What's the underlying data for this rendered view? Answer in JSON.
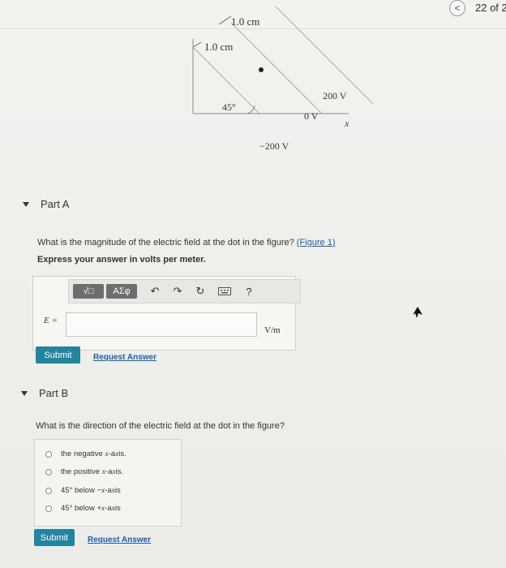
{
  "topbar": {
    "page_count": "22 of 2",
    "prev_symbol": "<"
  },
  "figure": {
    "label_top": "1.0 cm",
    "label_left": "1.0 cm",
    "label_angle": "45°",
    "label_200": "200 V",
    "label_0": "0 V",
    "label_neg200": "−200 V",
    "label_x": "x"
  },
  "part_a": {
    "header": "Part A",
    "question": "What is the magnitude of the electric field at the dot in the figure? ",
    "figure_link": "(Figure 1)",
    "instruction": "Express your answer in volts per meter.",
    "toolbar": {
      "templates_label": "√□",
      "greek_label": "ΑΣφ",
      "help_label": "?"
    },
    "variable": "E =",
    "input_value": "",
    "unit": "V/m",
    "submit": "Submit",
    "request": "Request Answer"
  },
  "part_b": {
    "header": "Part B",
    "question": "What is the direction of the electric field at the dot in the figure?",
    "choices": [
      "the negative x-axis.",
      "the positive x-axis.",
      "45° below −x-axis",
      "45° below +x-axis"
    ],
    "submit": "Submit",
    "request": "Request Answer"
  }
}
